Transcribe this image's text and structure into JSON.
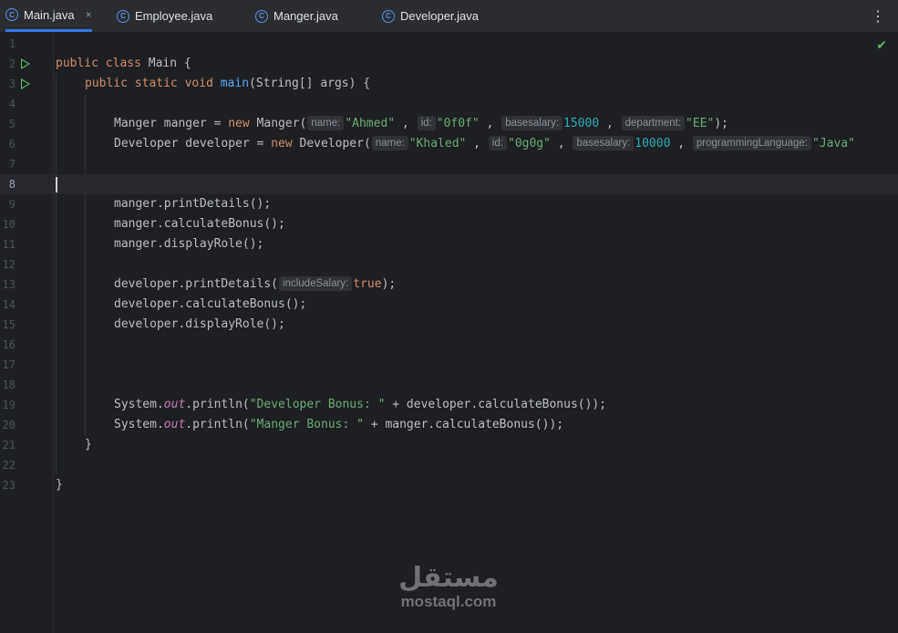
{
  "tabs": [
    {
      "label": "Main.java",
      "active": true,
      "icon": "java-class-icon",
      "close": "×"
    },
    {
      "label": "Employee.java",
      "active": false,
      "icon": "java-class-icon"
    },
    {
      "label": "Manger.java",
      "active": false,
      "icon": "java-class-icon"
    },
    {
      "label": "Developer.java",
      "active": false,
      "icon": "java-class-icon"
    }
  ],
  "editor": {
    "current_line": 8,
    "status_icon": "check-icon",
    "line_numbers": [
      "1",
      "2",
      "3",
      "4",
      "5",
      "6",
      "7",
      "8",
      "9",
      "10",
      "11",
      "12",
      "13",
      "14",
      "15",
      "16",
      "17",
      "18",
      "19",
      "20",
      "21",
      "22",
      "23"
    ],
    "lines": {
      "l2": {
        "kw1": "public",
        "kw2": "class",
        "rest": " Main {"
      },
      "l3": {
        "kw1": "public",
        "kw2": "static",
        "kw3": "void",
        "fn": "main",
        "rest": "(String[] args) {"
      },
      "l5": {
        "decl": "Manger manger = ",
        "kw": "new",
        "ctor": " Manger(",
        "h1": "name:",
        "v1": "\"Ahmed\"",
        "h2": "id:",
        "v2": "\"0f0f\"",
        "h3": "basesalary:",
        "v3": "15000",
        "h4": "department:",
        "v4": "\"EE\"",
        "end": ");",
        "sep": " , "
      },
      "l6": {
        "decl": "Developer developer = ",
        "kw": "new",
        "ctor": " Developer(",
        "h1": "name:",
        "v1": "\"Khaled\"",
        "h2": "id:",
        "v2": "\"0g0g\"",
        "h3": "basesalary:",
        "v3": "10000",
        "h4": "programmingLanguage:",
        "v4": "\"Java\"",
        "sep": " , "
      },
      "l9": "manger.printDetails();",
      "l10": "manger.calculateBonus();",
      "l11": "manger.displayRole();",
      "l13": {
        "pre": "developer.printDetails(",
        "hint": "includeSalary:",
        "val": "true",
        "end": ");"
      },
      "l14": "developer.calculateBonus();",
      "l15": "developer.displayRole();",
      "l19": {
        "pre": "System.",
        "field": "out",
        "mid": ".println(",
        "str": "\"Developer Bonus: \"",
        "post": " + developer.calculateBonus());"
      },
      "l20": {
        "pre": "System.",
        "field": "out",
        "mid": ".println(",
        "str": "\"Manger Bonus: \"",
        "post": " + manger.calculateBonus());"
      },
      "l21": "}",
      "l23": "}"
    }
  },
  "watermark": {
    "arabic": "مستقل",
    "latin": "mostaql.com"
  }
}
